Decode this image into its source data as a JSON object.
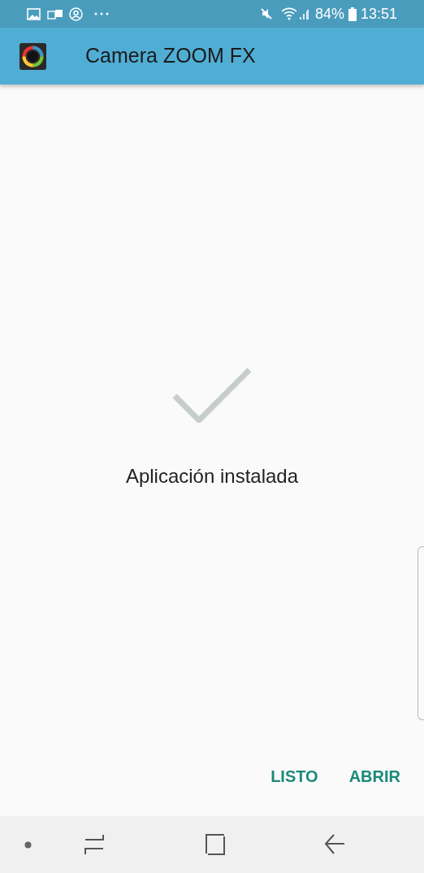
{
  "status_bar": {
    "battery": "84%",
    "time": "13:51"
  },
  "app_bar": {
    "title": "Camera ZOOM FX"
  },
  "message": "Aplicación instalada",
  "buttons": [
    "LISTO",
    "ABRIR"
  ]
}
